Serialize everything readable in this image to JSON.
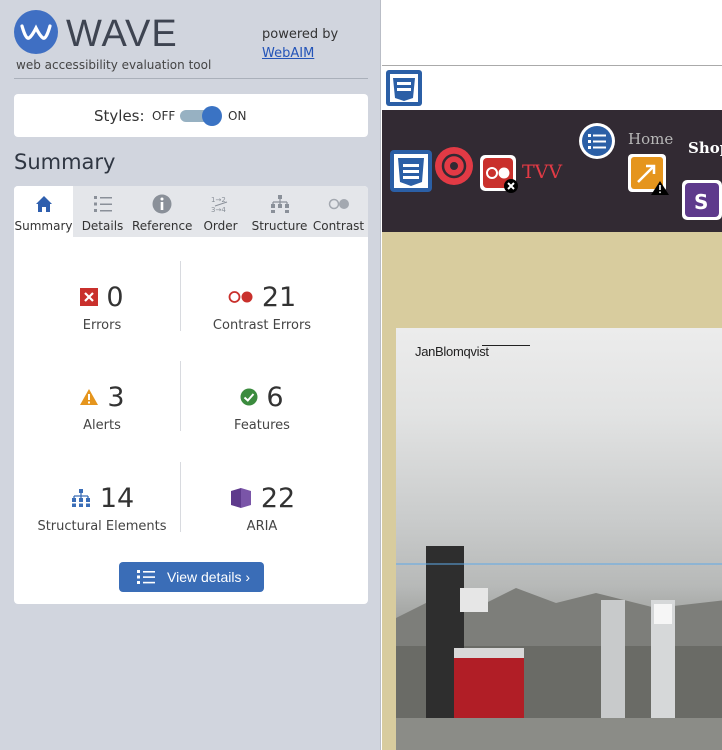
{
  "wave": {
    "logo_text": "WAVE",
    "subtitle": "web accessibility evaluation tool",
    "powered_by": "powered by",
    "webaim_link": "WebAIM"
  },
  "styles": {
    "label": "Styles:",
    "off": "OFF",
    "on": "ON",
    "state": "on"
  },
  "summary_title": "Summary",
  "tabs": [
    {
      "label": "Summary",
      "icon": "home-icon",
      "active": true
    },
    {
      "label": "Details",
      "icon": "list-icon",
      "active": false
    },
    {
      "label": "Reference",
      "icon": "info-icon",
      "active": false
    },
    {
      "label": "Order",
      "icon": "order-icon",
      "active": false
    },
    {
      "label": "Structure",
      "icon": "structure-icon",
      "active": false
    },
    {
      "label": "Contrast",
      "icon": "contrast-icon",
      "active": false
    }
  ],
  "stats": {
    "errors": {
      "value": "0",
      "label": "Errors",
      "color": "#c9302c"
    },
    "contrast_errors": {
      "value": "21",
      "label": "Contrast Errors",
      "color": "#c9302c"
    },
    "alerts": {
      "value": "3",
      "label": "Alerts",
      "color": "#e5951d"
    },
    "features": {
      "value": "6",
      "label": "Features",
      "color": "#3b8b3e"
    },
    "structural": {
      "value": "14",
      "label": "Structural Elements",
      "color": "#3a6db7"
    },
    "aria": {
      "value": "22",
      "label": "ARIA",
      "color": "#5e3a8c"
    }
  },
  "view_details": "View details ›",
  "preview": {
    "nav_home": "Home",
    "nav_shop": "Shop",
    "tvv_label": "TVV",
    "album_artist": "JanBlomqvist"
  },
  "colors": {
    "accent": "#3a6db7",
    "sidebar_bg": "#d1d5de",
    "nav_bg": "#322a33",
    "band_bg": "#d8cc9e"
  }
}
